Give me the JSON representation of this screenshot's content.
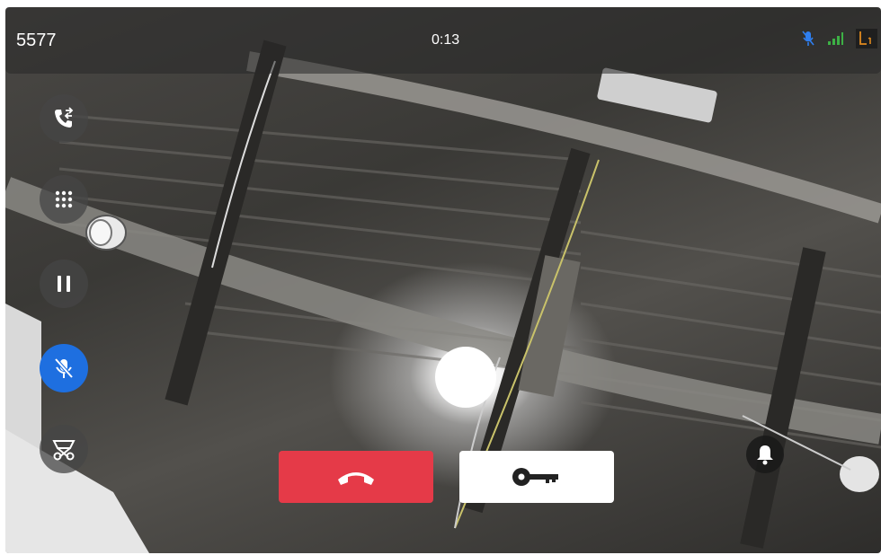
{
  "call": {
    "number": "5577",
    "duration": "0:13"
  },
  "status_icons": [
    "mic-muted-icon",
    "signal-strength-icon",
    "line-l1-icon"
  ],
  "side_controls": [
    {
      "name": "transfer-call-button",
      "icon": "phone-transfer-icon",
      "active": false
    },
    {
      "name": "dialpad-button",
      "icon": "dialpad-icon",
      "active": false
    },
    {
      "name": "hold-button",
      "icon": "pause-icon",
      "active": false
    },
    {
      "name": "mute-button",
      "icon": "mic-off-icon",
      "active": true
    },
    {
      "name": "video-off-button",
      "icon": "camera-swap-icon",
      "active": false
    }
  ],
  "bottom_actions": [
    {
      "name": "end-call-button",
      "icon": "hang-up-icon",
      "color": "#e53a48"
    },
    {
      "name": "unlock-door-button",
      "icon": "key-icon",
      "color": "#ffffff"
    }
  ],
  "overlay": {
    "icon": "bell-icon"
  },
  "colors": {
    "accent": "#1e6fe0",
    "hangup": "#e53a48",
    "signal": "#3db045",
    "line": "#e08a1e"
  }
}
